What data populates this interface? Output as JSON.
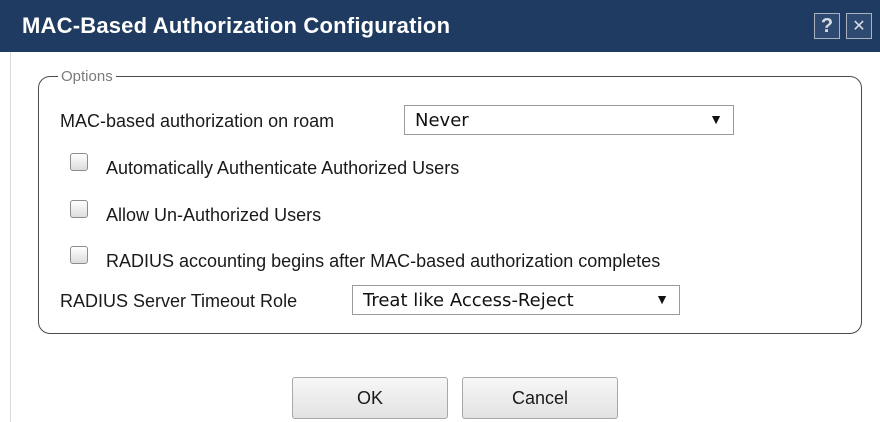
{
  "dialog": {
    "title": "MAC-Based Authorization Configuration",
    "help_glyph": "?",
    "close_glyph": "✕"
  },
  "options": {
    "legend": "Options",
    "mac_auth_roam": {
      "label": "MAC-based authorization on roam",
      "value": "Never"
    },
    "checkboxes": [
      {
        "label": "Automatically Authenticate Authorized Users",
        "checked": false
      },
      {
        "label": "Allow Un-Authorized Users",
        "checked": false
      },
      {
        "label": "RADIUS accounting begins after MAC-based authorization completes",
        "checked": false
      }
    ],
    "timeout_role": {
      "label": "RADIUS Server Timeout Role",
      "value": "Treat like Access-Reject"
    },
    "dropdown_arrow": "▼"
  },
  "buttons": {
    "ok": "OK",
    "cancel": "Cancel"
  },
  "colors": {
    "titlebar": "#1f3b61",
    "title_text": "#ffffff",
    "legend_text": "#7a7a7a"
  }
}
